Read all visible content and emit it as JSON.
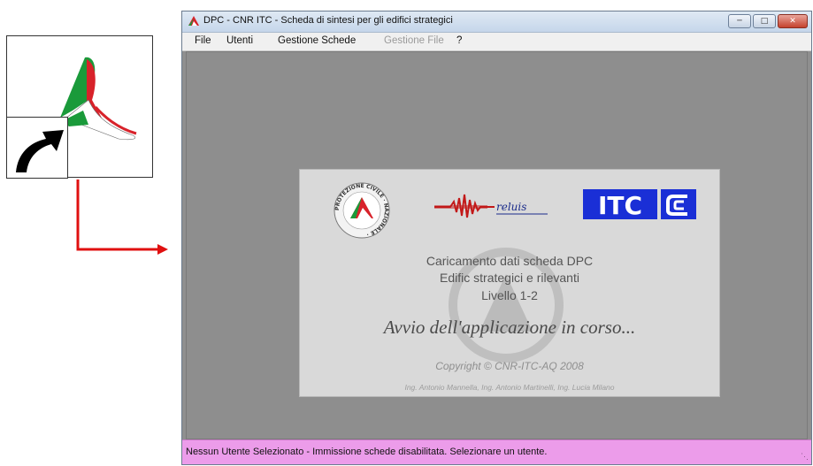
{
  "shortcut": {
    "icon": "dpc-logo-icon",
    "overlay_icon": "shortcut-arrow-icon"
  },
  "window": {
    "title": "DPC - CNR ITC - Scheda di sintesi per gli edifici strategici",
    "controls": {
      "minimize": "minimize-icon",
      "maximize": "maximize-icon",
      "close": "close-icon"
    }
  },
  "menu": {
    "file": "File",
    "utenti": "Utenti",
    "gestione_schede": "Gestione Schede",
    "gestione_file": "Gestione File",
    "help": "?"
  },
  "splash": {
    "logos": {
      "pc_ring_text": "PROTEZIONE CIVILE · NAZIONALE ·",
      "reluis": "reluis",
      "itc": "ITC"
    },
    "line1": "Caricamento dati scheda DPC",
    "line2": "Edific strategici e rilevanti",
    "line3": "Livello 1-2",
    "loading": "Avvio dell'applicazione in corso...",
    "copyright": "Copyright © CNR-ITC-AQ 2008",
    "authors": "Ing. Antonio Mannella, Ing. Antonio Martinelli, Ing. Lucia Milano"
  },
  "status": {
    "text": "Nessun Utente Selezionato - Immissione schede disabilitata. Selezionare un utente."
  },
  "colors": {
    "status_bg": "#ec9cea",
    "connector": "#e01010",
    "itc_blue": "#1a2fd6"
  }
}
